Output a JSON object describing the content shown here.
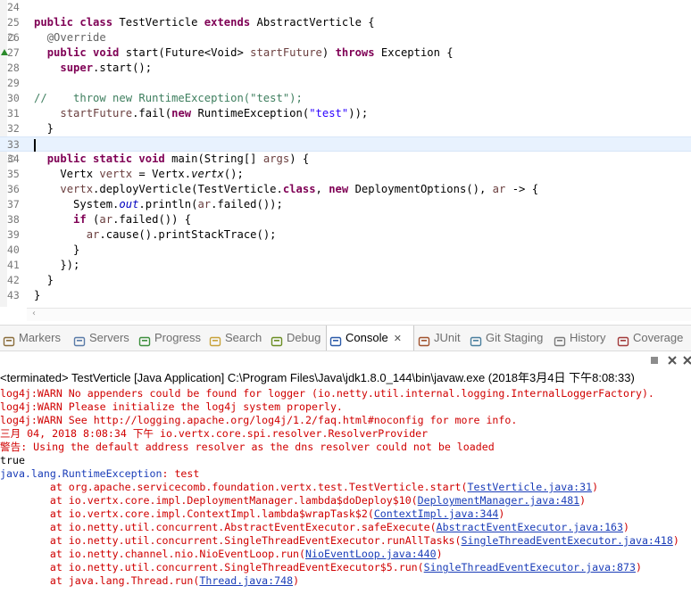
{
  "editor": {
    "lines": [
      {
        "n": "24",
        "html": ""
      },
      {
        "n": "25",
        "html": "<span class='kw'>public class</span> TestVerticle <span class='kw'>extends</span> AbstractVerticle {"
      },
      {
        "n": "26",
        "html": "  <span class='ann'>@Override</span>",
        "fold": true
      },
      {
        "n": "27",
        "html": "  <span class='kw'>public void</span> start(Future&lt;Void&gt; <span class='par'>startFuture</span>) <span class='kw'>throws</span> Exception {",
        "override": true
      },
      {
        "n": "28",
        "html": "    <span class='kw'>super</span>.start();"
      },
      {
        "n": "29",
        "html": ""
      },
      {
        "n": "30",
        "html": "<span class='cmt'>//    throw new RuntimeException(\"test\");</span>"
      },
      {
        "n": "31",
        "html": "    <span class='par'>startFuture</span>.fail(<span class='kw'>new</span> RuntimeException(<span class='str'>\"test\"</span>));"
      },
      {
        "n": "32",
        "html": "  }"
      },
      {
        "n": "33",
        "html": "<span class='caret'></span>",
        "current": true
      },
      {
        "n": "34",
        "html": "  <span class='kw'>public static void</span> main(String[] <span class='par'>args</span>) {",
        "fold": true
      },
      {
        "n": "35",
        "html": "    Vertx <span class='par'>vertx</span> = Vertx.<i>vertx</i>();"
      },
      {
        "n": "36",
        "html": "    <span class='par'>vertx</span>.deployVerticle(TestVerticle.<span class='kw'>class</span>, <span class='kw'>new</span> DeploymentOptions(), <span class='par'>ar</span> -&gt; {"
      },
      {
        "n": "37",
        "html": "      System.<span class='fld'>out</span>.println(<span class='par'>ar</span>.failed());"
      },
      {
        "n": "38",
        "html": "      <span class='kw'>if</span> (<span class='par'>ar</span>.failed()) {"
      },
      {
        "n": "39",
        "html": "        <span class='par'>ar</span>.cause().printStackTrace();"
      },
      {
        "n": "40",
        "html": "      }"
      },
      {
        "n": "41",
        "html": "    });"
      },
      {
        "n": "42",
        "html": "  }"
      },
      {
        "n": "43",
        "html": "}"
      }
    ]
  },
  "tabs": [
    {
      "label": "Markers",
      "icon": "markers-icon",
      "color": "#8a6d3b"
    },
    {
      "label": "Servers",
      "icon": "servers-icon",
      "color": "#5a7ba8"
    },
    {
      "label": "Progress",
      "icon": "progress-icon",
      "color": "#3d8f3d"
    },
    {
      "label": "Search",
      "icon": "search-icon",
      "color": "#c8a23a"
    },
    {
      "label": "Debug",
      "icon": "debug-icon",
      "color": "#6b8e23"
    },
    {
      "label": "Console",
      "icon": "console-icon",
      "color": "#2b5aa8",
      "active": true
    },
    {
      "label": "JUnit",
      "icon": "junit-icon",
      "color": "#a0522d"
    },
    {
      "label": "Git Staging",
      "icon": "git-staging-icon",
      "color": "#4a7f9e"
    },
    {
      "label": "History",
      "icon": "history-icon",
      "color": "#7a7a7a"
    },
    {
      "label": "Coverage",
      "icon": "coverage-icon",
      "color": "#a23a3a"
    }
  ],
  "console": {
    "terminated_label": "<terminated> TestVerticle [Java Application] C:\\Program Files\\Java\\jdk1.8.0_144\\bin\\javaw.exe (2018年3月4日 下午8:08:33)",
    "lines": [
      {
        "t": "err",
        "text": "log4j:WARN No appenders could be found for logger (io.netty.util.internal.logging.InternalLoggerFactory)."
      },
      {
        "t": "err",
        "text": "log4j:WARN Please initialize the log4j system properly."
      },
      {
        "t": "err",
        "text": "log4j:WARN See http://logging.apache.org/log4j/1.2/faq.html#noconfig for more info."
      },
      {
        "t": "err",
        "text": "三月 04, 2018 8:08:34 下午 io.vertx.core.spi.resolver.ResolverProvider"
      },
      {
        "t": "err",
        "text": "警告: Using the default address resolver as the dns resolver could not be loaded"
      },
      {
        "t": "out",
        "text": "true"
      },
      {
        "t": "exc",
        "link": "java.lang.RuntimeException",
        "rest": ": test"
      },
      {
        "t": "st",
        "pre": "\tat org.apache.servicecomb.foundation.vertx.test.TestVerticle.start(",
        "link": "TestVerticle.java:31",
        "post": ")"
      },
      {
        "t": "st",
        "pre": "\tat io.vertx.core.impl.DeploymentManager.lambda$doDeploy$10(",
        "link": "DeploymentManager.java:481",
        "post": ")"
      },
      {
        "t": "st",
        "pre": "\tat io.vertx.core.impl.ContextImpl.lambda$wrapTask$2(",
        "link": "ContextImpl.java:344",
        "post": ")"
      },
      {
        "t": "st",
        "pre": "\tat io.netty.util.concurrent.AbstractEventExecutor.safeExecute(",
        "link": "AbstractEventExecutor.java:163",
        "post": ")"
      },
      {
        "t": "st",
        "pre": "\tat io.netty.util.concurrent.SingleThreadEventExecutor.runAllTasks(",
        "link": "SingleThreadEventExecutor.java:418",
        "post": ")"
      },
      {
        "t": "st",
        "pre": "\tat io.netty.channel.nio.NioEventLoop.run(",
        "link": "NioEventLoop.java:440",
        "post": ")"
      },
      {
        "t": "st",
        "pre": "\tat io.netty.util.concurrent.SingleThreadEventExecutor$5.run(",
        "link": "SingleThreadEventExecutor.java:873",
        "post": ")"
      },
      {
        "t": "st",
        "pre": "\tat java.lang.Thread.run(",
        "link": "Thread.java:748",
        "post": ")"
      }
    ]
  },
  "toolbar": {
    "stop_icon": "stop-icon",
    "remove_icon": "remove-launch-icon",
    "remove_all_icon": "remove-all-terminated-icon"
  },
  "colors": {
    "keyword": "#7f0055",
    "string": "#2a00ff",
    "comment": "#3f7f5f",
    "error": "#d00000",
    "link": "#1a3db8",
    "current_line": "#e8f2fe"
  }
}
